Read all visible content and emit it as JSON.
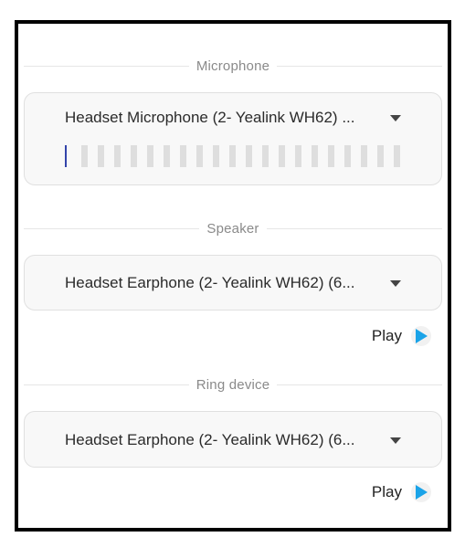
{
  "microphone": {
    "section_label": "Microphone",
    "device": "Headset Microphone (2- Yealink WH62) ...",
    "level": 0.05
  },
  "speaker": {
    "section_label": "Speaker",
    "device": "Headset Earphone (2- Yealink WH62) (6...",
    "play_label": "Play"
  },
  "ring": {
    "section_label": "Ring device",
    "device": "Headset Earphone (2- Yealink WH62) (6...",
    "play_label": "Play"
  },
  "colors": {
    "accent_play": "#1aa3e8",
    "level_active": "#3344aa",
    "level_inactive": "#dedede"
  },
  "icons": {
    "dropdown": "chevron-down-icon",
    "play": "play-icon"
  }
}
